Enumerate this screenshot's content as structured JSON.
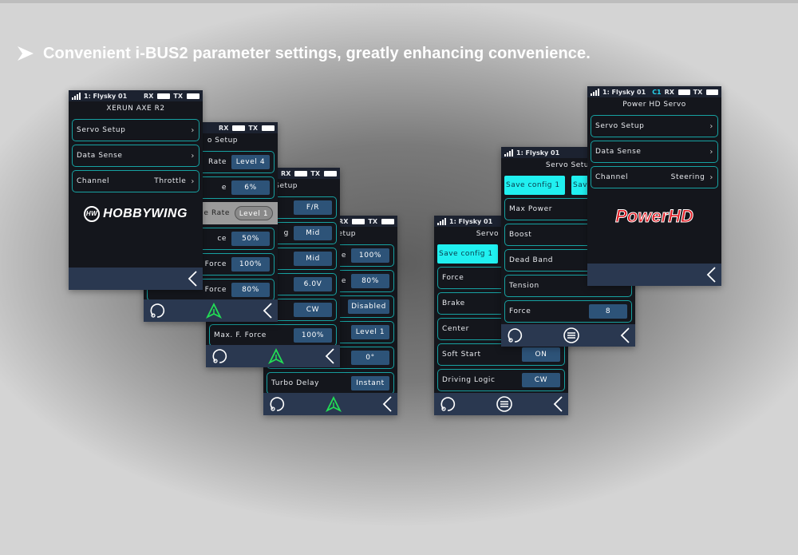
{
  "headline": {
    "icon": "arrow-right-icon",
    "text": "Convenient i-BUS2 parameter settings, greatly enhancing convenience."
  },
  "colors": {
    "row_border": "#17a1a1",
    "value_bg": "#2d5378",
    "save_bg": "#20f0f0",
    "bottom_bar": "#2a3850",
    "nav_green": "#22dd55",
    "c1": "#27d4ee"
  },
  "screens": [
    {
      "id": "s4",
      "status": {
        "signal": false,
        "model": "",
        "c1": "",
        "rx": "RX",
        "tx": "TX"
      },
      "title": "etup",
      "rows": [
        {
          "label": "e",
          "value": "100%"
        },
        {
          "label": "e",
          "value": "80%"
        },
        {
          "label": "",
          "value": "Disabled"
        },
        {
          "label": "",
          "value": "Level 1"
        },
        {
          "label": "",
          "value": "0°"
        },
        {
          "label": "Turbo Delay",
          "value": "Instant"
        }
      ],
      "bottom": [
        "refresh-icon",
        "navigation-icon",
        "back-icon"
      ]
    },
    {
      "id": "s3",
      "status": {
        "signal": false,
        "model": "",
        "c1": "",
        "rx": "RX",
        "tx": "TX"
      },
      "title": "Setup",
      "rows": [
        {
          "label": "",
          "value": "F/R"
        },
        {
          "label": "g",
          "value": "Mid"
        },
        {
          "label": "",
          "value": "Mid"
        },
        {
          "label": "",
          "value": "6.0V"
        },
        {
          "label": "",
          "value": "CW"
        },
        {
          "label": "Max. F. Force",
          "value": "100%"
        }
      ],
      "bottom": [
        "refresh-icon",
        "navigation-icon",
        "back-icon"
      ]
    },
    {
      "id": "s2",
      "status": {
        "signal": false,
        "model": "",
        "c1": "",
        "rx": "RX",
        "tx": "TX"
      },
      "title": "o Setup",
      "rows": [
        {
          "label": "Rate",
          "value": "Level 4"
        },
        {
          "label": "e",
          "value": "6%"
        },
        {
          "label": "e Rate",
          "value": "Level 1",
          "highlight": true
        },
        {
          "label": "ce",
          "value": "50%"
        },
        {
          "label": "Force",
          "value": "100%"
        },
        {
          "label": "Force",
          "value": "80%"
        }
      ],
      "bottom": [
        "refresh-icon",
        "navigation-icon",
        "back-icon"
      ]
    },
    {
      "id": "s1",
      "status": {
        "signal": true,
        "model": "1: Flysky 01",
        "c1": "",
        "rx": "RX",
        "tx": "TX"
      },
      "title": "XERUN AXE R2",
      "rows": [
        {
          "label": "Servo Setup",
          "value": "",
          "chevron": true
        },
        {
          "label": "Data Sense",
          "value": "",
          "chevron": true
        },
        {
          "label": "Channel",
          "value": "Throttle",
          "chevron": true
        }
      ],
      "logo": {
        "kind": "hobbywing",
        "text": "HOBBYWING",
        "mark": "HW"
      },
      "bottom": [
        "back-icon"
      ]
    },
    {
      "id": "s5",
      "status": {
        "signal": true,
        "model": "1: Flysky 01",
        "c1": "",
        "rx": "",
        "tx": ""
      },
      "title": "Servo",
      "saves": [
        "Save config 1"
      ],
      "rows": [
        {
          "label": "Force",
          "value": ""
        },
        {
          "label": "Brake",
          "value": ""
        },
        {
          "label": "Center",
          "value": ""
        },
        {
          "label": "Soft Start",
          "value": "ON"
        },
        {
          "label": "Driving Logic",
          "value": "CW"
        }
      ],
      "bottom": [
        "refresh-icon",
        "menu-icon",
        "back-icon"
      ]
    },
    {
      "id": "s6",
      "status": {
        "signal": true,
        "model": "1: Flysky 01",
        "c1": "C1",
        "rx": "RX",
        "tx": ""
      },
      "title": "Servo Setu",
      "saves": [
        "Save config 1",
        "Sav"
      ],
      "rows": [
        {
          "label": "Max Power",
          "value": ""
        },
        {
          "label": "Boost",
          "value": ""
        },
        {
          "label": "Dead Band",
          "value": ""
        },
        {
          "label": "Tension",
          "value": ""
        },
        {
          "label": "Force",
          "value": "8"
        }
      ],
      "bottom": [
        "refresh-icon",
        "menu-icon",
        "back-icon"
      ]
    },
    {
      "id": "s7",
      "status": {
        "signal": true,
        "model": "1: Flysky 01",
        "c1": "C1",
        "rx": "RX",
        "tx": "TX"
      },
      "title": "Power HD Servo",
      "rows": [
        {
          "label": "Servo Setup",
          "value": "",
          "chevron": true
        },
        {
          "label": "Data Sense",
          "value": "",
          "chevron": true
        },
        {
          "label": "Channel",
          "value": "Steering",
          "chevron": true
        }
      ],
      "logo": {
        "kind": "powerhd",
        "text": "PowerHD"
      },
      "bottom": [
        "back-icon"
      ]
    }
  ]
}
